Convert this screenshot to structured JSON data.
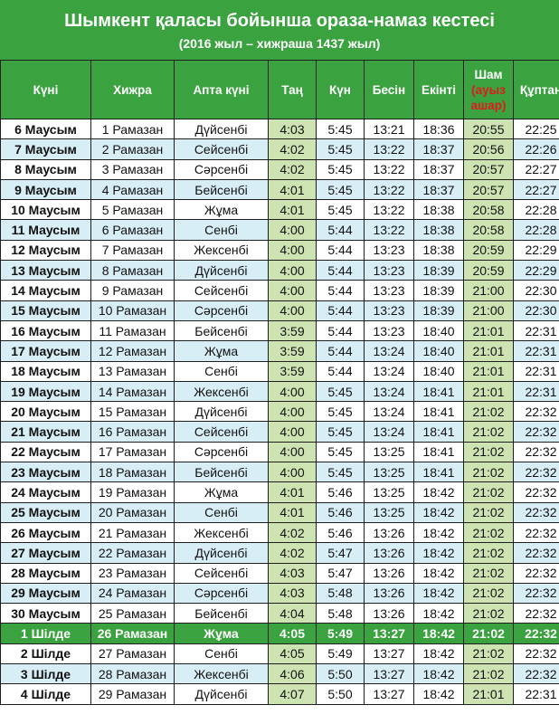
{
  "header": {
    "title": "Шымкент қаласы бойынша ораза-намаз кестесі",
    "subtitle": "(2016 жыл – хижраша 1437 жыл)"
  },
  "columns": {
    "date": "Күні",
    "hijri": "Хижра",
    "weekday": "Апта күні",
    "tan": "Таң",
    "kun": "Күн",
    "besin": "Бесін",
    "ekinti": "Екінті",
    "sham": "Шам",
    "sham_note": "(ауыз ашар)",
    "quptan": "Құптан"
  },
  "colors": {
    "header_green": "#3aa23f",
    "alt_row_blue": "#d8eef6",
    "highlight_cell_green": "#cde4b2",
    "iftar_red": "#e01b1b"
  },
  "highlighted_row": "1 Шілде",
  "rows": [
    {
      "date": "6 Маусым",
      "hijri": "1 Рамазан",
      "weekday": "Дүйсенбі",
      "tan": "4:03",
      "kun": "5:45",
      "besin": "13:21",
      "ekinti": "18:36",
      "sham": "20:55",
      "quptan": "22:25"
    },
    {
      "date": "7 Маусым",
      "hijri": "2 Рамазан",
      "weekday": "Сейсенбі",
      "tan": "4:02",
      "kun": "5:45",
      "besin": "13:22",
      "ekinti": "18:37",
      "sham": "20:56",
      "quptan": "22:26"
    },
    {
      "date": "8 Маусым",
      "hijri": "3 Рамазан",
      "weekday": "Сәрсенбі",
      "tan": "4:02",
      "kun": "5:45",
      "besin": "13:22",
      "ekinti": "18:37",
      "sham": "20:57",
      "quptan": "22:27"
    },
    {
      "date": "9 Маусым",
      "hijri": "4 Рамазан",
      "weekday": "Бейсенбі",
      "tan": "4:01",
      "kun": "5:45",
      "besin": "13:22",
      "ekinti": "18:37",
      "sham": "20:57",
      "quptan": "22:27"
    },
    {
      "date": "10 Маусым",
      "hijri": "5 Рамазан",
      "weekday": "Жұма",
      "tan": "4:01",
      "kun": "5:45",
      "besin": "13:22",
      "ekinti": "18:38",
      "sham": "20:58",
      "quptan": "22:28"
    },
    {
      "date": "11 Маусым",
      "hijri": "6 Рамазан",
      "weekday": "Сенбі",
      "tan": "4:00",
      "kun": "5:44",
      "besin": "13:22",
      "ekinti": "18:38",
      "sham": "20:58",
      "quptan": "22:28"
    },
    {
      "date": "12 Маусым",
      "hijri": "7 Рамазан",
      "weekday": "Жексенбі",
      "tan": "4:00",
      "kun": "5:44",
      "besin": "13:23",
      "ekinti": "18:38",
      "sham": "20:59",
      "quptan": "22:29"
    },
    {
      "date": "13 Маусым",
      "hijri": "8 Рамазан",
      "weekday": "Дүйсенбі",
      "tan": "4:00",
      "kun": "5:44",
      "besin": "13:23",
      "ekinti": "18:39",
      "sham": "20:59",
      "quptan": "22:29"
    },
    {
      "date": "14 Маусым",
      "hijri": "9 Рамазан",
      "weekday": "Сейсенбі",
      "tan": "4:00",
      "kun": "5:44",
      "besin": "13:23",
      "ekinti": "18:39",
      "sham": "21:00",
      "quptan": "22:30"
    },
    {
      "date": "15 Маусым",
      "hijri": "10 Рамазан",
      "weekday": "Сәрсенбі",
      "tan": "4:00",
      "kun": "5:44",
      "besin": "13:23",
      "ekinti": "18:39",
      "sham": "21:00",
      "quptan": "22:30"
    },
    {
      "date": "16 Маусым",
      "hijri": "11 Рамазан",
      "weekday": "Бейсенбі",
      "tan": "3:59",
      "kun": "5:44",
      "besin": "13:23",
      "ekinti": "18:40",
      "sham": "21:01",
      "quptan": "22:31"
    },
    {
      "date": "17 Маусым",
      "hijri": "12 Рамазан",
      "weekday": "Жұма",
      "tan": "3:59",
      "kun": "5:44",
      "besin": "13:24",
      "ekinti": "18:40",
      "sham": "21:01",
      "quptan": "22:31"
    },
    {
      "date": "18 Маусым",
      "hijri": "13 Рамазан",
      "weekday": "Сенбі",
      "tan": "3:59",
      "kun": "5:44",
      "besin": "13:24",
      "ekinti": "18:40",
      "sham": "21:01",
      "quptan": "22:31"
    },
    {
      "date": "19 Маусым",
      "hijri": "14 Рамазан",
      "weekday": "Жексенбі",
      "tan": "4:00",
      "kun": "5:45",
      "besin": "13:24",
      "ekinti": "18:41",
      "sham": "21:01",
      "quptan": "22:31"
    },
    {
      "date": "20 Маусым",
      "hijri": "15 Рамазан",
      "weekday": "Дүйсенбі",
      "tan": "4:00",
      "kun": "5:45",
      "besin": "13:24",
      "ekinti": "18:41",
      "sham": "21:02",
      "quptan": "22:32"
    },
    {
      "date": "21 Маусым",
      "hijri": "16 Рамазан",
      "weekday": "Сейсенбі",
      "tan": "4:00",
      "kun": "5:45",
      "besin": "13:24",
      "ekinti": "18:41",
      "sham": "21:02",
      "quptan": "22:32"
    },
    {
      "date": "22 Маусым",
      "hijri": "17 Рамазан",
      "weekday": "Сәрсенбі",
      "tan": "4:00",
      "kun": "5:45",
      "besin": "13:25",
      "ekinti": "18:41",
      "sham": "21:02",
      "quptan": "22:32"
    },
    {
      "date": "23 Маусым",
      "hijri": "18 Рамазан",
      "weekday": "Бейсенбі",
      "tan": "4:00",
      "kun": "5:45",
      "besin": "13:25",
      "ekinti": "18:41",
      "sham": "21:02",
      "quptan": "22:32"
    },
    {
      "date": "24 Маусым",
      "hijri": "19 Рамазан",
      "weekday": "Жұма",
      "tan": "4:01",
      "kun": "5:46",
      "besin": "13:25",
      "ekinti": "18:42",
      "sham": "21:02",
      "quptan": "22:32"
    },
    {
      "date": "25 Маусым",
      "hijri": "20 Рамазан",
      "weekday": "Сенбі",
      "tan": "4:01",
      "kun": "5:46",
      "besin": "13:25",
      "ekinti": "18:42",
      "sham": "21:02",
      "quptan": "22:32"
    },
    {
      "date": "26 Маусым",
      "hijri": "21 Рамазан",
      "weekday": "Жексенбі",
      "tan": "4:02",
      "kun": "5:46",
      "besin": "13:26",
      "ekinti": "18:42",
      "sham": "21:02",
      "quptan": "22:32"
    },
    {
      "date": "27 Маусым",
      "hijri": "22 Рамазан",
      "weekday": "Дүйсенбі",
      "tan": "4:02",
      "kun": "5:47",
      "besin": "13:26",
      "ekinti": "18:42",
      "sham": "21:02",
      "quptan": "22:32"
    },
    {
      "date": "28 Маусым",
      "hijri": "23 Рамазан",
      "weekday": "Сейсенбі",
      "tan": "4:03",
      "kun": "5:47",
      "besin": "13:26",
      "ekinti": "18:42",
      "sham": "21:02",
      "quptan": "22:32"
    },
    {
      "date": "29 Маусым",
      "hijri": "24 Рамазан",
      "weekday": "Сәрсенбі",
      "tan": "4:03",
      "kun": "5:48",
      "besin": "13:26",
      "ekinti": "18:42",
      "sham": "21:02",
      "quptan": "22:32"
    },
    {
      "date": "30 Маусым",
      "hijri": "25 Рамазан",
      "weekday": "Бейсенбі",
      "tan": "4:04",
      "kun": "5:48",
      "besin": "13:26",
      "ekinti": "18:42",
      "sham": "21:02",
      "quptan": "22:32"
    },
    {
      "date": "1 Шілде",
      "hijri": "26 Рамазан",
      "weekday": "Жұма",
      "tan": "4:05",
      "kun": "5:49",
      "besin": "13:27",
      "ekinti": "18:42",
      "sham": "21:02",
      "quptan": "22:32"
    },
    {
      "date": "2 Шілде",
      "hijri": "27 Рамазан",
      "weekday": "Сенбі",
      "tan": "4:05",
      "kun": "5:49",
      "besin": "13:27",
      "ekinti": "18:42",
      "sham": "21:02",
      "quptan": "22:32"
    },
    {
      "date": "3 Шілде",
      "hijri": "28 Рамазан",
      "weekday": "Жексенбі",
      "tan": "4:06",
      "kun": "5:50",
      "besin": "13:27",
      "ekinti": "18:42",
      "sham": "21:02",
      "quptan": "22:32"
    },
    {
      "date": "4 Шілде",
      "hijri": "29 Рамазан",
      "weekday": "Дүйсенбі",
      "tan": "4:07",
      "kun": "5:50",
      "besin": "13:27",
      "ekinti": "18:42",
      "sham": "21:01",
      "quptan": "22:31"
    }
  ]
}
